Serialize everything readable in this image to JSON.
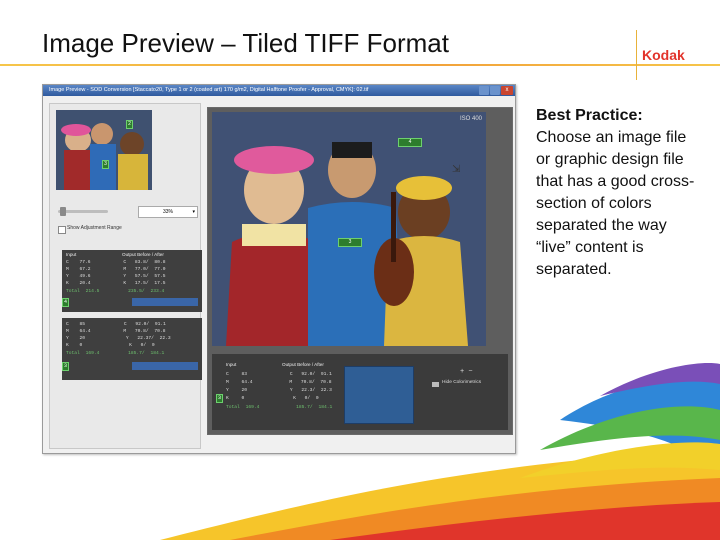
{
  "slide": {
    "title": "Image Preview – Tiled TIFF Format",
    "logo_text": "Kodak"
  },
  "window": {
    "title": "Image Preview - SOD Conversion [Staccato20, Type 1 or 2 (coated art) 170 g/m2, Digital Halftone Proofer - Approval, CMYK]: 02.tif",
    "close_glyph": "x"
  },
  "left_panel": {
    "zoom_value": "33%",
    "zoom_arrow": "▾",
    "show_adjustment_label": "Show Adjustment Range",
    "readout_a": {
      "input_label": "Input",
      "output_label": "Output Before / After",
      "marker": "4",
      "rows": [
        {
          "ink": "C",
          "value": "77.6",
          "out_ink": "C",
          "before": "83.8/",
          "after": "80.8"
        },
        {
          "ink": "M",
          "value": "67.2",
          "out_ink": "M",
          "before": "77.0/",
          "after": "77.0"
        },
        {
          "ink": "Y",
          "value": "49.6",
          "out_ink": "Y",
          "before": "57.5/",
          "after": "57.5"
        },
        {
          "ink": "K",
          "value": "20.4",
          "out_ink": "K",
          "before": "17.5/",
          "after": "17.5"
        }
      ],
      "total_label": "Total",
      "total_input": "214.5",
      "total_before": "235.5/",
      "total_after": "233.4"
    },
    "readout_b": {
      "marker": "3",
      "rows": [
        {
          "ink": "C",
          "value": "85",
          "out_ink": "C",
          "before": "92.0/",
          "after": "91.1"
        },
        {
          "ink": "M",
          "value": "64.4",
          "out_ink": "M",
          "before": "70.8/",
          "after": "70.8"
        },
        {
          "ink": "Y",
          "value": "20",
          "out_ink": "Y",
          "before": "22.37/",
          "after": "22.3"
        },
        {
          "ink": "K",
          "value": "0",
          "out_ink": "K",
          "before": "0/",
          "after": "0"
        }
      ],
      "total_label": "Total",
      "total_input": "169.4",
      "total_before": "185.7/",
      "total_after": "184.1"
    }
  },
  "viewer": {
    "iso_label": "ISO 400",
    "marker_top": "4",
    "marker_mid": "3",
    "marker_thumb_top": "2",
    "marker_thumb_mid": "3",
    "cursor_glyph": "⇲",
    "bottom_readout": {
      "input_label": "Input",
      "output_label": "Output Before / After",
      "marker": "3",
      "rows": [
        {
          "ink": "C",
          "value": "83",
          "out_ink": "C",
          "before": "92.0/",
          "after": "91.1"
        },
        {
          "ink": "M",
          "value": "64.4",
          "out_ink": "M",
          "before": "70.8/",
          "after": "70.8"
        },
        {
          "ink": "Y",
          "value": "20",
          "out_ink": "Y",
          "before": "22.3/",
          "after": "22.3"
        },
        {
          "ink": "K",
          "value": "0",
          "out_ink": "K",
          "before": "0/",
          "after": "0"
        }
      ],
      "total_label": "Total",
      "total_input": "169.4",
      "total_before": "185.7/",
      "total_after": "184.1"
    },
    "zoom_icons": "+ −",
    "hide_col_label": "Hide Colorimetrics"
  },
  "best_practice": {
    "heading": "Best Practice:",
    "body": "Choose an image file or graphic design file that has a good cross-section of colors separated the way “live” content is separated."
  }
}
